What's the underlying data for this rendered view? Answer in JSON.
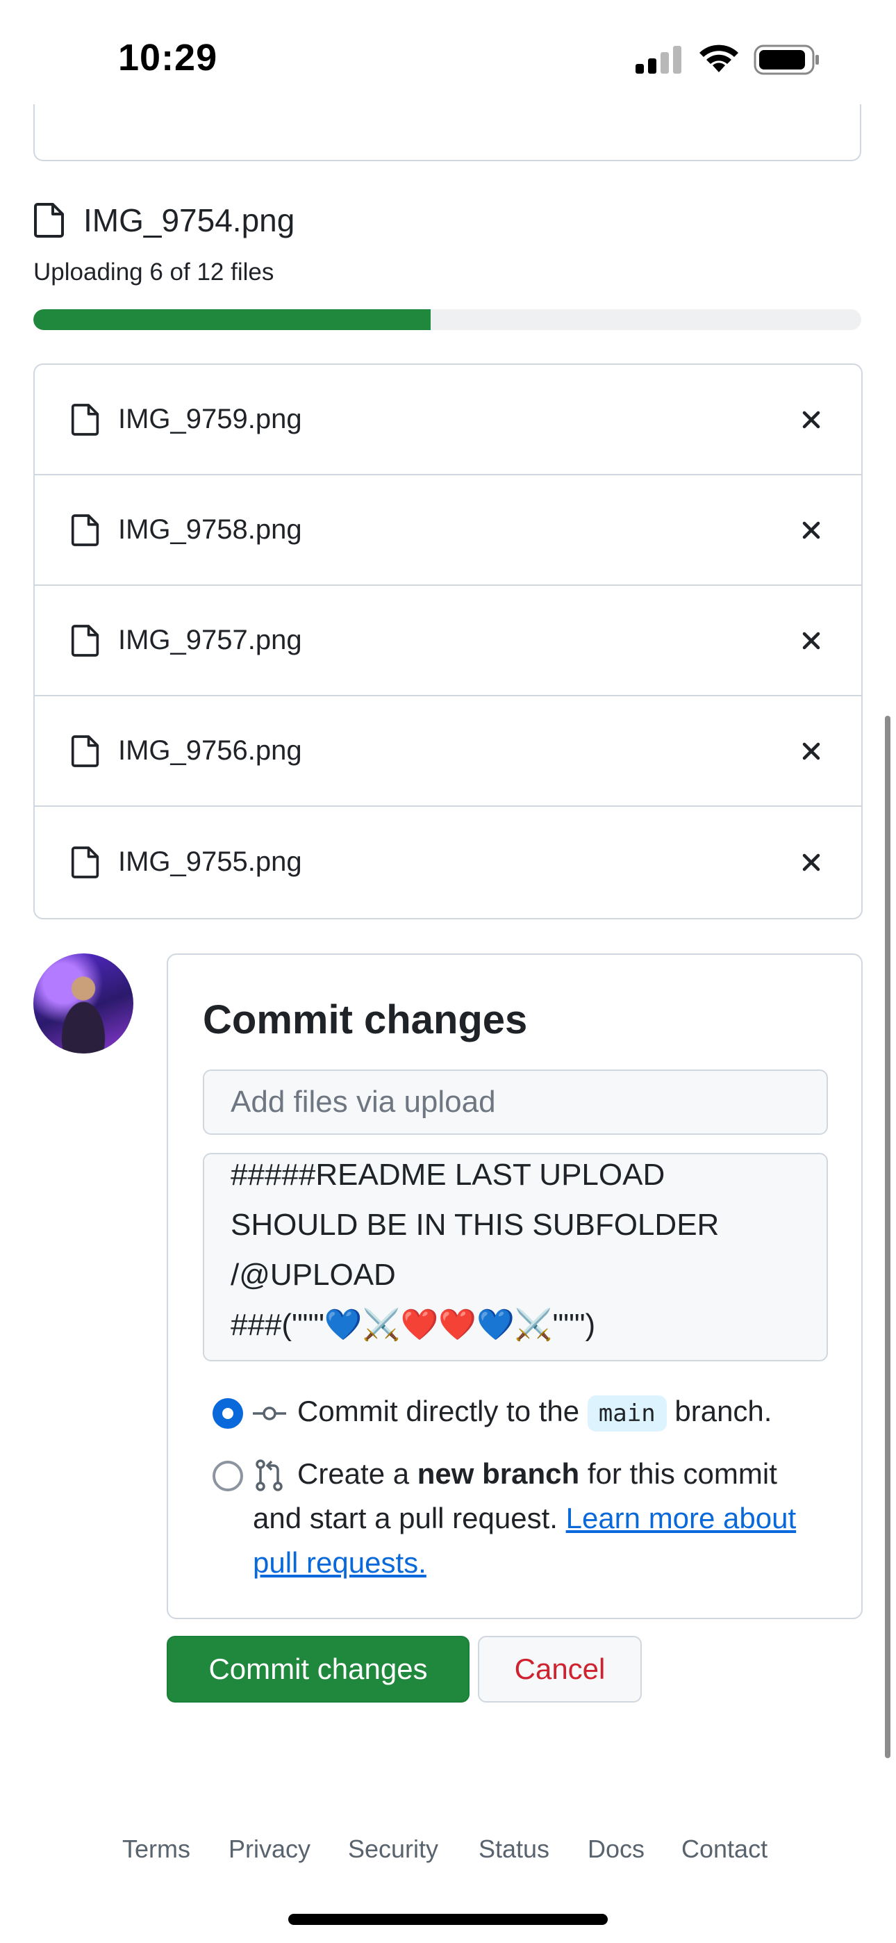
{
  "status_bar": {
    "time": "10:29"
  },
  "upload": {
    "current_file": "IMG_9754.png",
    "status_text": "Uploading 6 of 12 files",
    "progress_fraction": 0.48,
    "files": [
      {
        "name": "IMG_9759.png"
      },
      {
        "name": "IMG_9758.png"
      },
      {
        "name": "IMG_9757.png"
      },
      {
        "name": "IMG_9756.png"
      },
      {
        "name": "IMG_9755.png"
      }
    ]
  },
  "commit": {
    "title": "Commit changes",
    "summary_placeholder": "Add files via upload",
    "description": "#####README LAST UPLOAD\nSHOULD BE IN THIS SUBFOLDER\n/@UPLOAD\n###(\"\"\"💙⚔️❤️❤️💙⚔️\"\"\")",
    "option_direct": {
      "prefix": "Commit directly to the",
      "branch": "main",
      "suffix": "branch."
    },
    "option_new": {
      "prefix": "Create a",
      "bold": "new branch",
      "middle": "for this commit and start a pull request.",
      "link": "Learn more about pull requests."
    },
    "submit_label": "Commit changes",
    "cancel_label": "Cancel"
  },
  "footer": {
    "links": [
      "Terms",
      "Privacy",
      "Security",
      "Status",
      "Docs",
      "Contact"
    ]
  },
  "colors": {
    "primary_green": "#1f883d",
    "link_blue": "#0969da",
    "danger_red": "#cf222e",
    "border": "#d0d7de"
  }
}
